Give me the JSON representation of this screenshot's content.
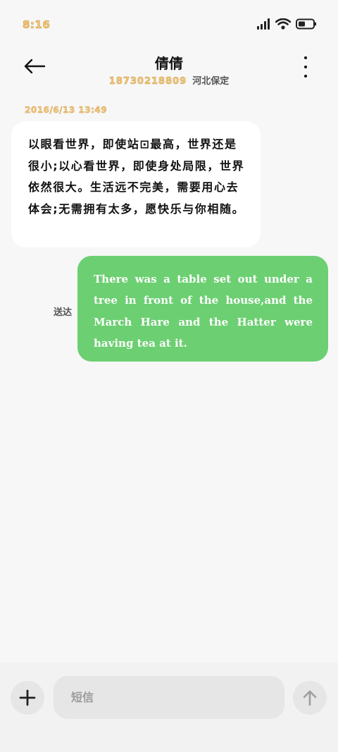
{
  "status_bar": {
    "time": "8:16",
    "icons": [
      "signal-icon",
      "wifi-icon",
      "battery-icon"
    ]
  },
  "header": {
    "contact_name": "倩倩",
    "phone_number": "18730218809",
    "location": "河北保定",
    "icons": [
      "back-arrow-icon",
      "more-vertical-icon"
    ]
  },
  "conversation": {
    "timestamp": "2016/6/13 13:49",
    "incoming_message": "以眼看世界，即使站⊡最高，世界还是很小;以心看世界，即使身处局限，世界依然很大。生活远不完美，需要用心去体会;无需拥有太多，愿快乐与你相随。",
    "delivery_status": "送达",
    "outgoing_message": "There was a table set out under a tree in front of the house,and the March Hare and the Hatter were having tea at it."
  },
  "composer": {
    "placeholder": "短信",
    "icons": [
      "plus-icon",
      "send-arrow-icon"
    ]
  },
  "colors": {
    "background": "#f7f7f7",
    "outgoing_bubble": "#6ccf72",
    "incoming_bubble": "#ffffff",
    "accent_time": "#f3c97d"
  }
}
